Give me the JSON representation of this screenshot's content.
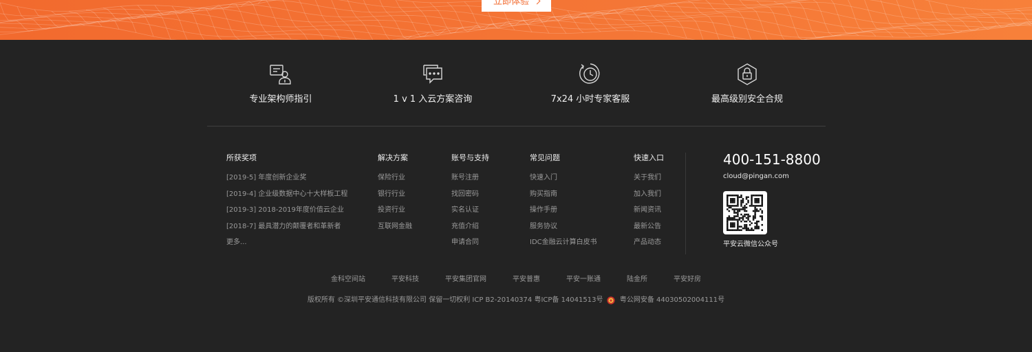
{
  "banner": {
    "cta_label": "立即体验",
    "colors": {
      "start": "#f26a2e",
      "end": "#f7803a"
    }
  },
  "features": [
    {
      "icon": "architect-guide-icon",
      "label": "专业架构师指引"
    },
    {
      "icon": "chat-consult-icon",
      "label": "1 v 1 入云方案咨询"
    },
    {
      "icon": "clock-service-icon",
      "label": "7x24 小时专家客服"
    },
    {
      "icon": "security-lock-icon",
      "label": "最高级别安全合规"
    }
  ],
  "columns": [
    {
      "title": "所获奖项",
      "items": [
        "[2019-5] 年度创新企业奖",
        "[2019-4] 企业级数据中心十大样板工程",
        "[2019-3] 2018-2019年度价值云企业",
        "[2018-7] 最具潜力的颠覆者和革新者",
        "更多..."
      ]
    },
    {
      "title": "解决方案",
      "items": [
        "保险行业",
        "银行行业",
        "投资行业",
        "互联网金融"
      ]
    },
    {
      "title": "账号与支持",
      "items": [
        "账号注册",
        "找回密码",
        "实名认证",
        "充值介绍",
        "申请合同"
      ]
    },
    {
      "title": "常见问题",
      "items": [
        "快速入门",
        "购买指南",
        "操作手册",
        "服务协议",
        "IDC金融云计算白皮书"
      ]
    },
    {
      "title": "快速入口",
      "items": [
        "关于我们",
        "加入我们",
        "新闻资讯",
        "最新公告",
        "产品动态"
      ]
    }
  ],
  "contact": {
    "phone": "400-151-8800",
    "email": "cloud@pingan.com",
    "qr_label": "平安云微信公众号"
  },
  "partners": [
    "金科空间站",
    "平安科技",
    "平安集团官网",
    "平安普惠",
    "平安一账通",
    "陆金所",
    "平安好房"
  ],
  "copyright": {
    "text": "版权所有 ©深圳平安通信科技有限公司  保留一切权利  ICP B2-20140374  粤ICP备  14041513号",
    "police_icon": "police-badge-icon",
    "police_text": "粤公网安备 44030502004111号"
  },
  "colors": {
    "background": "#232323",
    "accent": "#f26a2e"
  }
}
